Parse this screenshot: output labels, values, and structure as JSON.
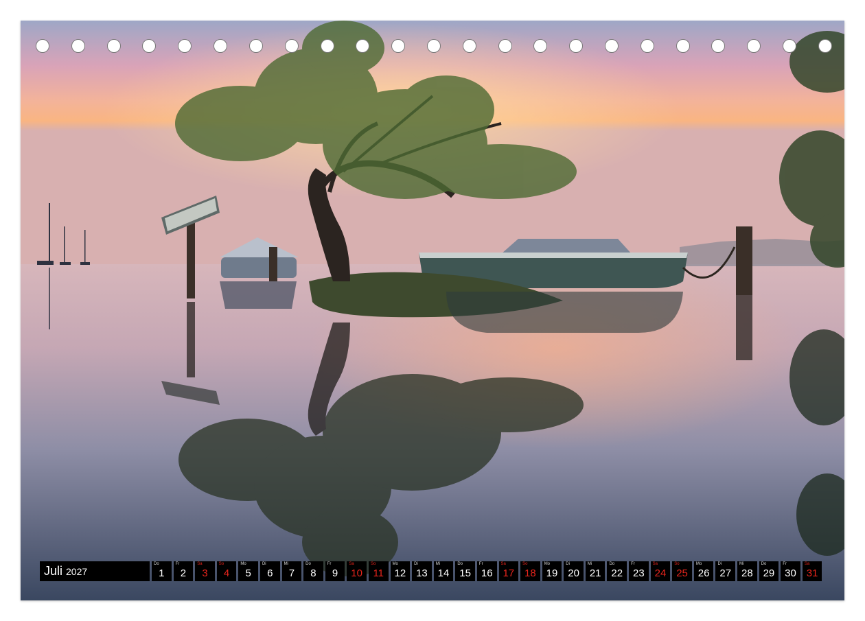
{
  "calendar": {
    "month": "Juli",
    "year": "2027",
    "weekend_color": "#e8251c",
    "days": [
      {
        "wd": "Do",
        "d": "1",
        "weekend": false
      },
      {
        "wd": "Fr",
        "d": "2",
        "weekend": false
      },
      {
        "wd": "Sa",
        "d": "3",
        "weekend": true
      },
      {
        "wd": "So",
        "d": "4",
        "weekend": true
      },
      {
        "wd": "Mo",
        "d": "5",
        "weekend": false
      },
      {
        "wd": "Di",
        "d": "6",
        "weekend": false
      },
      {
        "wd": "Mi",
        "d": "7",
        "weekend": false
      },
      {
        "wd": "Do",
        "d": "8",
        "weekend": false
      },
      {
        "wd": "Fr",
        "d": "9",
        "weekend": false
      },
      {
        "wd": "Sa",
        "d": "10",
        "weekend": true
      },
      {
        "wd": "So",
        "d": "11",
        "weekend": true
      },
      {
        "wd": "Mo",
        "d": "12",
        "weekend": false
      },
      {
        "wd": "Di",
        "d": "13",
        "weekend": false
      },
      {
        "wd": "Mi",
        "d": "14",
        "weekend": false
      },
      {
        "wd": "Do",
        "d": "15",
        "weekend": false
      },
      {
        "wd": "Fr",
        "d": "16",
        "weekend": false
      },
      {
        "wd": "Sa",
        "d": "17",
        "weekend": true
      },
      {
        "wd": "So",
        "d": "18",
        "weekend": true
      },
      {
        "wd": "Mo",
        "d": "19",
        "weekend": false
      },
      {
        "wd": "Di",
        "d": "20",
        "weekend": false
      },
      {
        "wd": "Mi",
        "d": "21",
        "weekend": false
      },
      {
        "wd": "Do",
        "d": "22",
        "weekend": false
      },
      {
        "wd": "Fr",
        "d": "23",
        "weekend": false
      },
      {
        "wd": "Sa",
        "d": "24",
        "weekend": true
      },
      {
        "wd": "So",
        "d": "25",
        "weekend": true
      },
      {
        "wd": "Mo",
        "d": "26",
        "weekend": false
      },
      {
        "wd": "Di",
        "d": "27",
        "weekend": false
      },
      {
        "wd": "Mi",
        "d": "28",
        "weekend": false
      },
      {
        "wd": "Do",
        "d": "29",
        "weekend": false
      },
      {
        "wd": "Fr",
        "d": "30",
        "weekend": false
      },
      {
        "wd": "Sa",
        "d": "31",
        "weekend": true
      }
    ]
  },
  "photo": {
    "sky_top": "#9aa6c4",
    "sky_glow": "#f6a36b",
    "water_dark": "#3c4a63",
    "tree_color": "#2a3a22"
  },
  "binding": {
    "hole_count": 23
  }
}
